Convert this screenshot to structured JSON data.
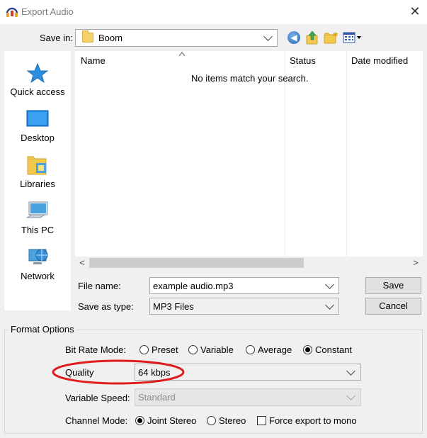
{
  "window": {
    "title": "Export Audio",
    "close_glyph": "✕"
  },
  "location": {
    "label": "Save in:",
    "folder": "Boom"
  },
  "toolbar": {
    "icons": [
      "back-icon",
      "up-folder-icon",
      "new-folder-icon",
      "views-menu-icon"
    ]
  },
  "places": [
    {
      "label": "Quick access",
      "icon": "quick-access-star-icon"
    },
    {
      "label": "Desktop",
      "icon": "desktop-icon"
    },
    {
      "label": "Libraries",
      "icon": "libraries-icon"
    },
    {
      "label": "This PC",
      "icon": "this-pc-icon"
    },
    {
      "label": "Network",
      "icon": "network-icon"
    }
  ],
  "file_list": {
    "columns": [
      "Name",
      "Status",
      "Date modified"
    ],
    "empty_message": "No items match your search."
  },
  "file_name": {
    "label": "File name:",
    "value": "example audio.mp3"
  },
  "file_type": {
    "label": "Save as type:",
    "value": "MP3 Files"
  },
  "buttons": {
    "save": "Save",
    "cancel": "Cancel"
  },
  "format_options": {
    "title": "Format Options",
    "bit_rate_mode": {
      "label": "Bit Rate Mode:",
      "options": [
        "Preset",
        "Variable",
        "Average",
        "Constant"
      ],
      "selected": "Constant"
    },
    "quality": {
      "label": "Quality",
      "value": "64 kbps"
    },
    "variable_speed": {
      "label": "Variable Speed:",
      "value": "Standard",
      "disabled": true
    },
    "channel_mode": {
      "label": "Channel Mode:",
      "options": [
        "Joint Stereo",
        "Stereo"
      ],
      "selected": "Joint Stereo",
      "force_mono_label": "Force export to mono",
      "force_mono_checked": false
    }
  },
  "colors": {
    "highlight_ellipse": "#e01b1b",
    "dialog_bg": "#f0f0f0"
  }
}
